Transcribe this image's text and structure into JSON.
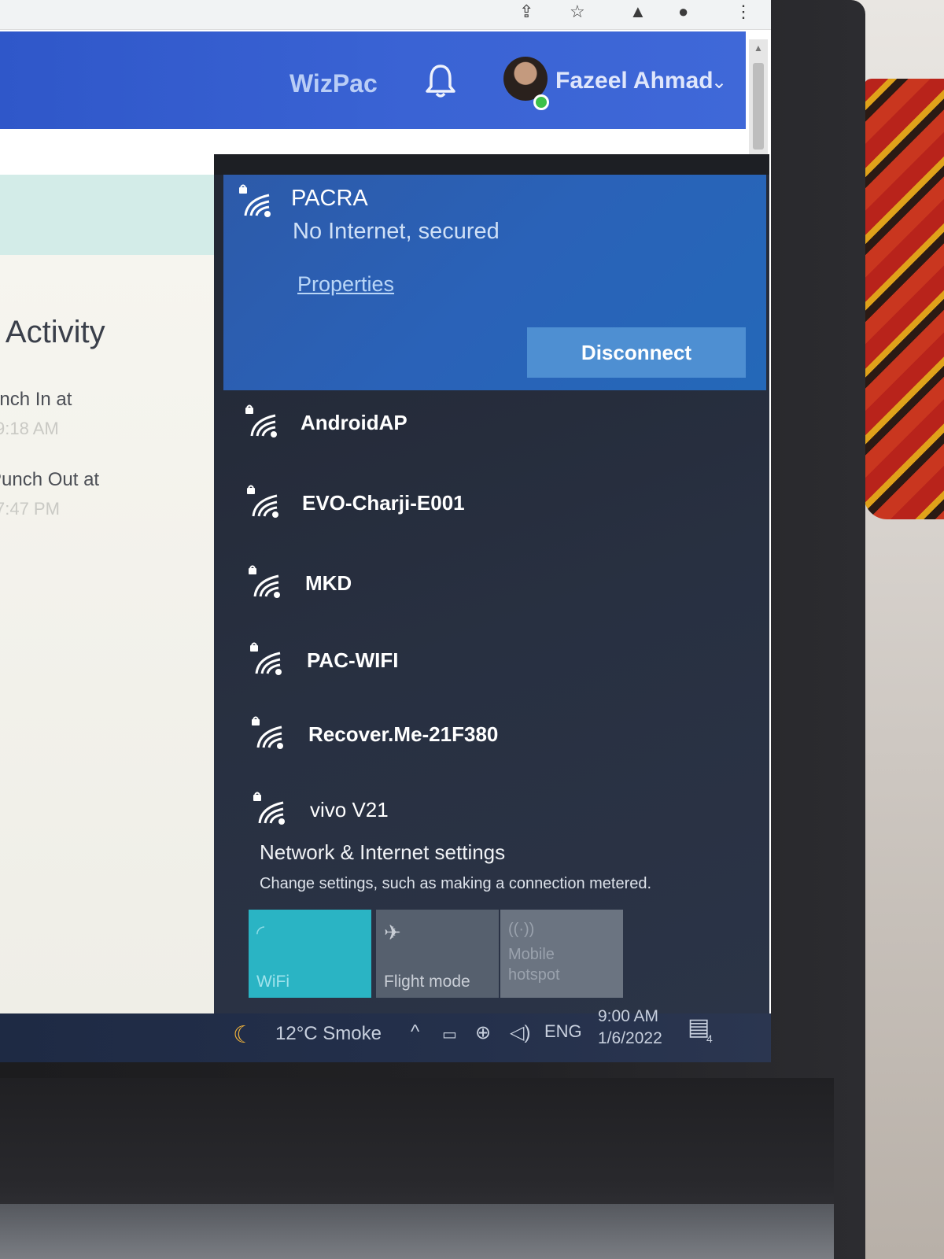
{
  "header": {
    "brand": "WizPac",
    "user_name": "Fazeel Ahmad"
  },
  "page": {
    "activity_title": "y Activity",
    "punch_in_label": "unch In at",
    "punch_in_time": "9:18 AM",
    "punch_out_label": "Punch Out at",
    "punch_out_time": "7:47 PM"
  },
  "network_flyout": {
    "connected": {
      "name": "PACRA",
      "status": "No Internet, secured",
      "properties_label": "Properties",
      "disconnect_label": "Disconnect"
    },
    "networks": [
      {
        "name": "AndroidAP",
        "secured": true
      },
      {
        "name": "EVO-Charji-E001",
        "secured": true
      },
      {
        "name": "MKD",
        "secured": true
      },
      {
        "name": "PAC-WIFI",
        "secured": true
      },
      {
        "name": "Recover.Me-21F380",
        "secured": true
      },
      {
        "name": "vivo V21",
        "secured": true
      }
    ],
    "settings_title": "Network & Internet settings",
    "settings_desc": "Change settings, such as making a connection metered.",
    "tiles": {
      "wifi": "WiFi",
      "flight": "Flight mode",
      "hotspot_line1": "Mobile",
      "hotspot_line2": "hotspot"
    }
  },
  "taskbar": {
    "weather": "12°C  Smoke",
    "language": "ENG",
    "time": "9:00 AM",
    "date": "1/6/2022",
    "notification_count": "4"
  },
  "colors": {
    "header_blue": "#3a63d4",
    "flyout_connected": "#2a62b8",
    "disconnect_button": "#4e8fd2",
    "wifi_tile_active": "#2ab4c4",
    "flyout_dark": "#283041"
  },
  "icons": [
    "lock-icon",
    "wifi-icon",
    "bell-icon",
    "chevron-down-icon",
    "airplane-icon",
    "hotspot-icon",
    "weather-icon",
    "globe-icon",
    "speaker-icon",
    "notification-icon"
  ]
}
